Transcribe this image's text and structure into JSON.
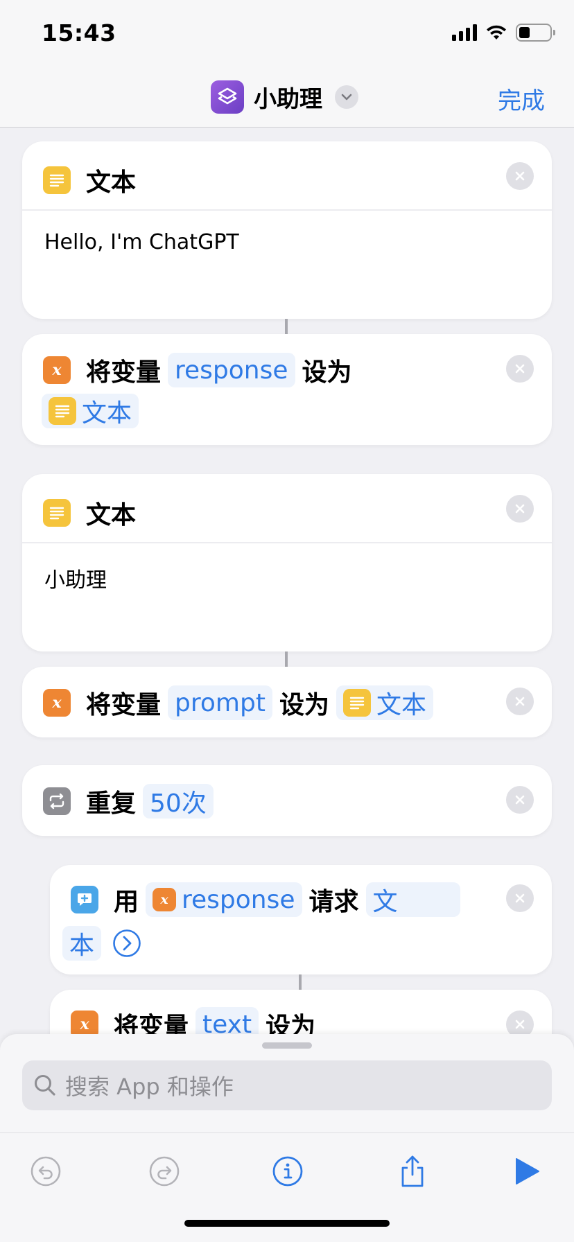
{
  "status_bar": {
    "time": "15:43"
  },
  "header": {
    "title": "小助理",
    "done_label": "完成"
  },
  "actions": [
    {
      "type": "text",
      "title": "文本",
      "content": "Hello, I'm ChatGPT"
    },
    {
      "type": "set_variable",
      "prefix": "将变量",
      "variable": "response",
      "middle": "设为",
      "value": "文本"
    },
    {
      "type": "text",
      "title": "文本",
      "content": "小助理"
    },
    {
      "type": "set_variable",
      "prefix": "将变量",
      "variable": "prompt",
      "middle": "设为",
      "value": "文本"
    },
    {
      "type": "repeat",
      "title": "重复",
      "count_label": "50次"
    },
    {
      "type": "request",
      "prefix": "用",
      "variable": "response",
      "middle": "请求",
      "value_part1": "文",
      "value_part2": "本"
    },
    {
      "type": "set_variable",
      "prefix": "将变量",
      "variable": "text",
      "middle": "设为"
    }
  ],
  "search": {
    "placeholder": "搜索 App 和操作"
  },
  "toolbar": {
    "icons": [
      "undo-icon",
      "redo-icon",
      "info-icon",
      "share-icon",
      "play-icon"
    ]
  },
  "colors": {
    "accent": "#2f7ae5",
    "text_action": "#f5c43c",
    "variable_action": "#ee8633",
    "repeat_action": "#8e8e93",
    "app_icon": "#7b4bd0"
  }
}
